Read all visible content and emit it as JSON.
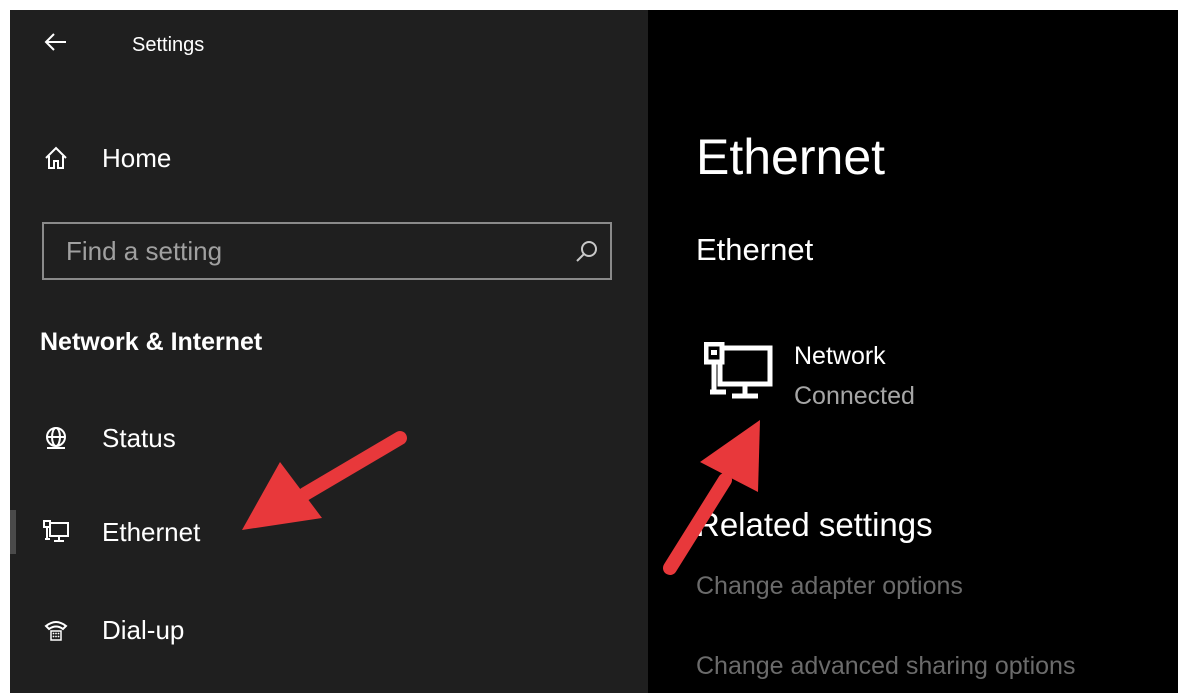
{
  "window": {
    "title": "Settings"
  },
  "sidebar": {
    "home_label": "Home",
    "search": {
      "placeholder": "Find a setting",
      "value": ""
    },
    "section_title": "Network & Internet",
    "items": [
      {
        "label": "Status",
        "icon": "globe-icon",
        "selected": false
      },
      {
        "label": "Ethernet",
        "icon": "ethernet-icon",
        "selected": true
      },
      {
        "label": "Dial-up",
        "icon": "dial-up-icon",
        "selected": false
      }
    ]
  },
  "main": {
    "page_title": "Ethernet",
    "section_title": "Ethernet",
    "network": {
      "name": "Network",
      "status": "Connected",
      "icon": "ethernet-computer-icon"
    },
    "related": {
      "title": "Related settings",
      "links": [
        "Change adapter options",
        "Change advanced sharing options"
      ]
    }
  },
  "annotations": {
    "arrow_color": "#e8383b"
  },
  "colors": {
    "sidebar_bg": "#1f1f1f",
    "main_bg": "#000000",
    "text_primary": "#ffffff",
    "text_secondary": "#a6a6a6",
    "link_disabled": "#6b6b6b"
  }
}
